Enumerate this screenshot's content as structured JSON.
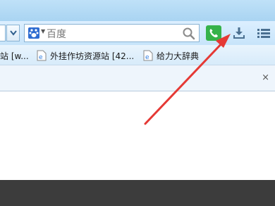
{
  "search": {
    "value": "百度",
    "engine_icon": "baidu-paw-icon"
  },
  "toolbar": {
    "phone_icon": "phone-icon",
    "download_icon": "download-icon",
    "menu_icon": "menu-list-icon"
  },
  "bookmarks": [
    {
      "label": "站 [w..."
    },
    {
      "label": "外挂作坊资源站 [42..."
    },
    {
      "label": "给力大辞典"
    }
  ],
  "tabbar": {
    "close": "×"
  },
  "annotation": {
    "color": "#e53935"
  }
}
